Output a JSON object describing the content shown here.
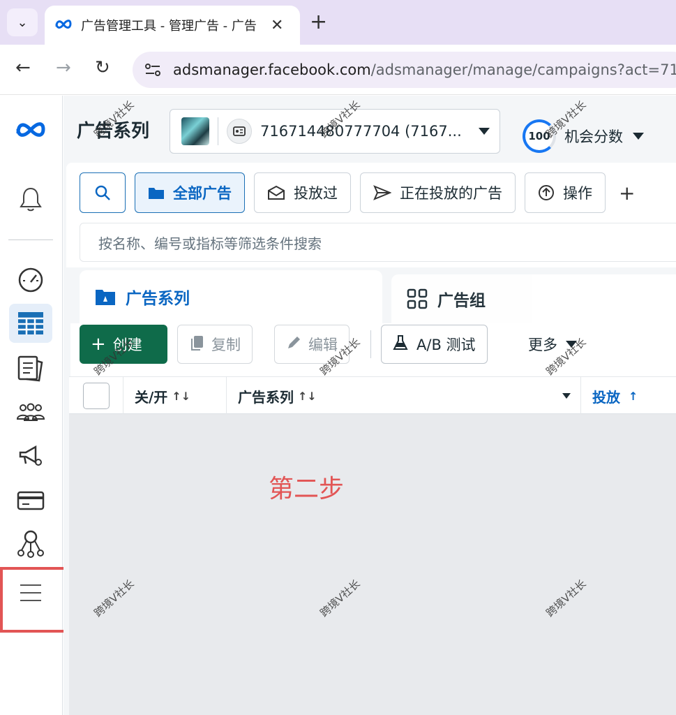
{
  "browser": {
    "tab_title": "广告管理工具 - 管理广告 - 广告",
    "url_host": "adsmanager.facebook.com",
    "url_path": "/adsmanager/manage/campaigns?act=71"
  },
  "header": {
    "page_title": "广告系列",
    "account_name": "716714480777704 (7167...",
    "opportunity_score": "100",
    "opportunity_label": "机会分数"
  },
  "filters": {
    "all_ads": "全部广告",
    "delivered": "投放过",
    "active_ads": "正在投放的广告",
    "actions": "操作",
    "add": "+",
    "search_placeholder": "按名称、编号或指标等筛选条件搜索"
  },
  "level_tabs": {
    "campaigns": "广告系列",
    "ad_sets": "广告组"
  },
  "toolbar": {
    "create": "创建",
    "duplicate": "复制",
    "edit": "编辑",
    "ab_test": "A/B 测试",
    "more": "更多"
  },
  "table": {
    "columns": [
      "关/开",
      "广告系列",
      "投放"
    ]
  },
  "annotation": {
    "step": "第二步",
    "watermark": "跨境V社长"
  },
  "colors": {
    "brand_blue": "#0a66c2",
    "create_green": "#0f6b4a",
    "annotation_red": "#e25555"
  }
}
